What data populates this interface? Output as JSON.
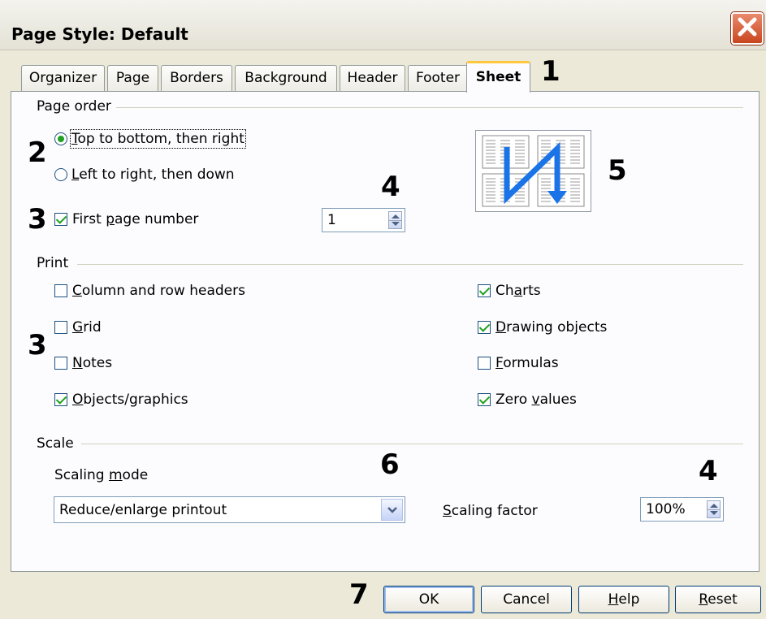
{
  "window": {
    "title": "Page Style: Default"
  },
  "tabs": [
    {
      "label": "Organizer"
    },
    {
      "label": "Page"
    },
    {
      "label": "Borders"
    },
    {
      "label": "Background"
    },
    {
      "label": "Header"
    },
    {
      "label": "Footer"
    },
    {
      "label": "Sheet",
      "active": true
    }
  ],
  "page_order": {
    "label": "Page order",
    "top_to_bottom": {
      "pre": "",
      "ul": "T",
      "post": "op to bottom, then right",
      "selected": true
    },
    "left_to_right": {
      "pre": "",
      "ul": "L",
      "post": "eft to right, then down",
      "selected": false
    },
    "first_page_number": {
      "pre": "First ",
      "ul": "p",
      "post": "age number",
      "checked": true,
      "value": "1"
    }
  },
  "print": {
    "label": "Print",
    "column_row_headers": {
      "pre": "",
      "ul": "C",
      "post": "olumn and row headers",
      "checked": false
    },
    "grid": {
      "pre": "",
      "ul": "G",
      "post": "rid",
      "checked": false
    },
    "notes": {
      "pre": "",
      "ul": "N",
      "post": "otes",
      "checked": false
    },
    "objects_graphics": {
      "pre": "",
      "ul": "O",
      "post": "bjects/graphics",
      "checked": true
    },
    "charts": {
      "pre": "Ch",
      "ul": "a",
      "post": "rts",
      "checked": true
    },
    "drawing_objects": {
      "pre": "",
      "ul": "D",
      "post": "rawing objects",
      "checked": true
    },
    "formulas": {
      "pre": "",
      "ul": "F",
      "post": "ormulas",
      "checked": false
    },
    "zero_values": {
      "pre": "Zero ",
      "ul": "v",
      "post": "alues",
      "checked": true
    }
  },
  "scale": {
    "label": "Scale",
    "scaling_mode": {
      "pre": "Scaling ",
      "ul": "m",
      "post": "ode"
    },
    "mode_value": "Reduce/enlarge printout",
    "scaling_factor": {
      "pre": "",
      "ul": "S",
      "post": "caling factor"
    },
    "factor_value": "100%"
  },
  "buttons": {
    "ok": "OK",
    "cancel": "Cancel",
    "help": {
      "pre": "",
      "ul": "H",
      "post": "elp"
    },
    "reset": {
      "pre": "",
      "ul": "R",
      "post": "eset"
    }
  },
  "callouts": {
    "c1": "1",
    "c2": "2",
    "c3a": "3",
    "c4a": "4",
    "c5": "5",
    "c3b": "3",
    "c6": "6",
    "c4b": "4",
    "c7": "7"
  },
  "icons": {
    "close": "close-x-icon",
    "page_order_preview": "page-order-preview-icon",
    "arrow_color": "#1a74e8"
  },
  "colors": {
    "dialog_bg": "#ece9d8",
    "panel_bg": "#fcfcfe",
    "active_tab_accent": "#ffc83c",
    "close_red": "#d15a33"
  }
}
